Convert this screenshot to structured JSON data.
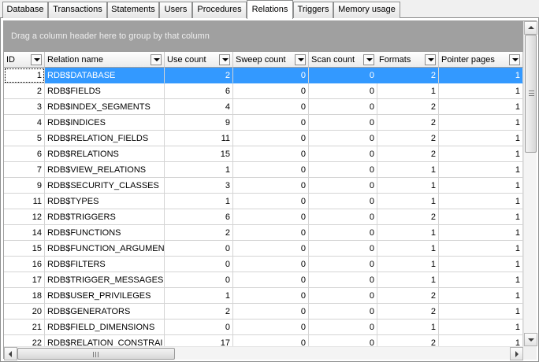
{
  "tabs": [
    {
      "label": "Database",
      "active": false
    },
    {
      "label": "Transactions",
      "active": false
    },
    {
      "label": "Statements",
      "active": false
    },
    {
      "label": "Users",
      "active": false
    },
    {
      "label": "Procedures",
      "active": false
    },
    {
      "label": "Relations",
      "active": true
    },
    {
      "label": "Triggers",
      "active": false
    },
    {
      "label": "Memory usage",
      "active": false
    }
  ],
  "group_hint": "Drag a column header here to group by that column",
  "columns": [
    "ID",
    "Relation name",
    "Use count",
    "Sweep count",
    "Scan count",
    "Formats",
    "Pointer pages"
  ],
  "rows": [
    [
      "1",
      "RDB$DATABASE",
      "2",
      "0",
      "0",
      "2",
      "1"
    ],
    [
      "2",
      "RDB$FIELDS",
      "6",
      "0",
      "0",
      "1",
      "1"
    ],
    [
      "3",
      "RDB$INDEX_SEGMENTS",
      "4",
      "0",
      "0",
      "2",
      "1"
    ],
    [
      "4",
      "RDB$INDICES",
      "9",
      "0",
      "0",
      "2",
      "1"
    ],
    [
      "5",
      "RDB$RELATION_FIELDS",
      "11",
      "0",
      "0",
      "2",
      "1"
    ],
    [
      "6",
      "RDB$RELATIONS",
      "15",
      "0",
      "0",
      "2",
      "1"
    ],
    [
      "7",
      "RDB$VIEW_RELATIONS",
      "1",
      "0",
      "0",
      "1",
      "1"
    ],
    [
      "9",
      "RDB$SECURITY_CLASSES",
      "3",
      "0",
      "0",
      "1",
      "1"
    ],
    [
      "11",
      "RDB$TYPES",
      "1",
      "0",
      "0",
      "1",
      "1"
    ],
    [
      "12",
      "RDB$TRIGGERS",
      "6",
      "0",
      "0",
      "2",
      "1"
    ],
    [
      "14",
      "RDB$FUNCTIONS",
      "2",
      "0",
      "0",
      "1",
      "1"
    ],
    [
      "15",
      "RDB$FUNCTION_ARGUMEN",
      "0",
      "0",
      "0",
      "1",
      "1"
    ],
    [
      "16",
      "RDB$FILTERS",
      "0",
      "0",
      "0",
      "1",
      "1"
    ],
    [
      "17",
      "RDB$TRIGGER_MESSAGES",
      "0",
      "0",
      "0",
      "1",
      "1"
    ],
    [
      "18",
      "RDB$USER_PRIVILEGES",
      "1",
      "0",
      "0",
      "2",
      "1"
    ],
    [
      "20",
      "RDB$GENERATORS",
      "2",
      "0",
      "0",
      "2",
      "1"
    ],
    [
      "21",
      "RDB$FIELD_DIMENSIONS",
      "0",
      "0",
      "0",
      "1",
      "1"
    ],
    [
      "22",
      "RDB$RELATION_CONSTRAI",
      "17",
      "0",
      "0",
      "2",
      "1"
    ]
  ],
  "selected_row": 0,
  "icons": {
    "column_dropdown": "chevron-down-icon",
    "scroll_up": "arrow-up-icon",
    "scroll_down": "arrow-down-icon",
    "scroll_left": "arrow-left-icon",
    "scroll_right": "arrow-right-icon"
  },
  "colors": {
    "selection": "#3399ff",
    "group_bar": "#a0a0a0"
  }
}
